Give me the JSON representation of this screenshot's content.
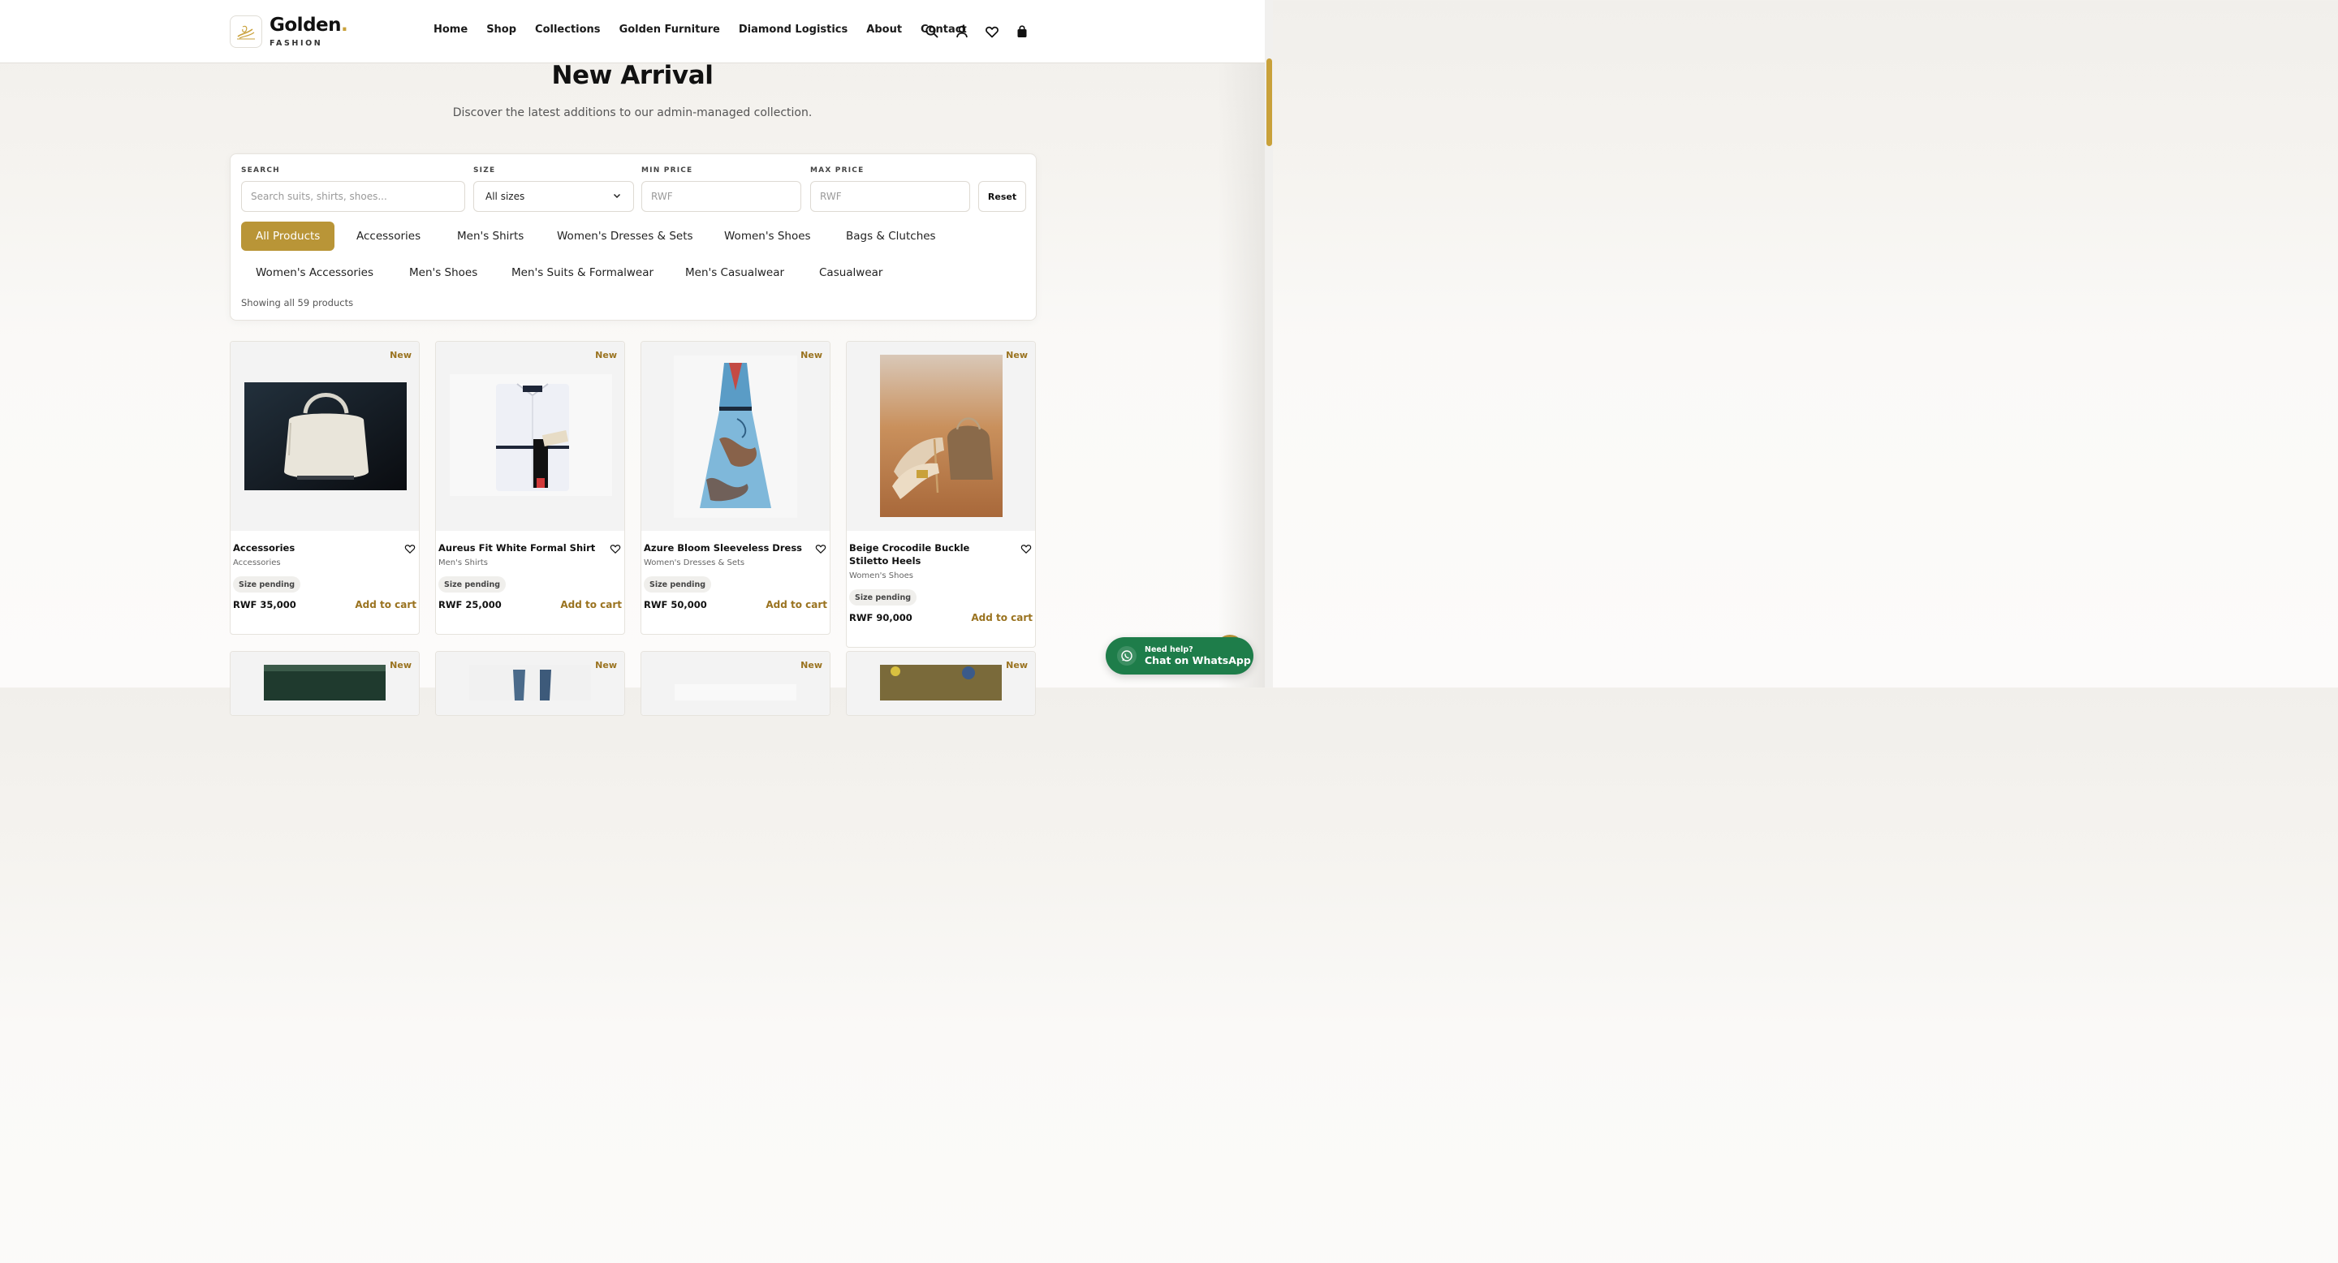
{
  "brand": {
    "name": "Golden",
    "dot": ".",
    "tagline": "FASHION"
  },
  "nav": {
    "items": [
      "Home",
      "Shop",
      "Collections",
      "Golden Furniture",
      "Diamond Logistics",
      "About",
      "Contact"
    ],
    "icons": [
      "search-icon",
      "user-icon",
      "heart-icon",
      "shopping-bag-icon"
    ]
  },
  "page": {
    "title": "New Arrival",
    "subtitle": "Discover the latest additions to our admin-managed collection."
  },
  "filters": {
    "search_label": "SEARCH",
    "search_placeholder": "Search suits, shirts, shoes...",
    "search_value": "",
    "size_label": "SIZE",
    "size_value": "All sizes",
    "min_label": "MIN PRICE",
    "min_placeholder": "RWF",
    "max_label": "MAX PRICE",
    "max_placeholder": "RWF",
    "reset_label": "Reset",
    "categories": [
      "All Products",
      "Accessories",
      "Men's Shirts",
      "Women's Dresses & Sets",
      "Women's Shoes",
      "Bags & Clutches",
      "Women's Accessories",
      "Men's Shoes",
      "Men's Suits & Formalwear",
      "Men's Casualwear",
      "Casualwear"
    ],
    "active_category": "All Products",
    "showing": "Showing all 59 products"
  },
  "products": [
    {
      "badge": "New",
      "name": "Accessories",
      "category": "Accessories",
      "size": "Size pending",
      "price": "RWF 35,000",
      "cta": "Add to cart"
    },
    {
      "badge": "New",
      "name": "Aureus Fit White Formal Shirt",
      "category": "Men's Shirts",
      "size": "Size pending",
      "price": "RWF 25,000",
      "cta": "Add to cart"
    },
    {
      "badge": "New",
      "name": "Azure Bloom Sleeveless Dress",
      "category": "Women's Dresses & Sets",
      "size": "Size pending",
      "price": "RWF 50,000",
      "cta": "Add to cart"
    },
    {
      "badge": "New",
      "name": "Beige Crocodile Buckle Stiletto Heels",
      "category": "Women's Shoes",
      "size": "Size pending",
      "price": "RWF 90,000",
      "cta": "Add to cart"
    },
    {
      "badge": "New"
    },
    {
      "badge": "New"
    },
    {
      "badge": "New"
    },
    {
      "badge": "New"
    }
  ],
  "whatsapp": {
    "line1": "Need help?",
    "line2": "Chat on WhatsApp"
  },
  "colors": {
    "gold": "#b99537",
    "gold_text": "#9a7320",
    "whatsapp": "#1e7d4a"
  }
}
